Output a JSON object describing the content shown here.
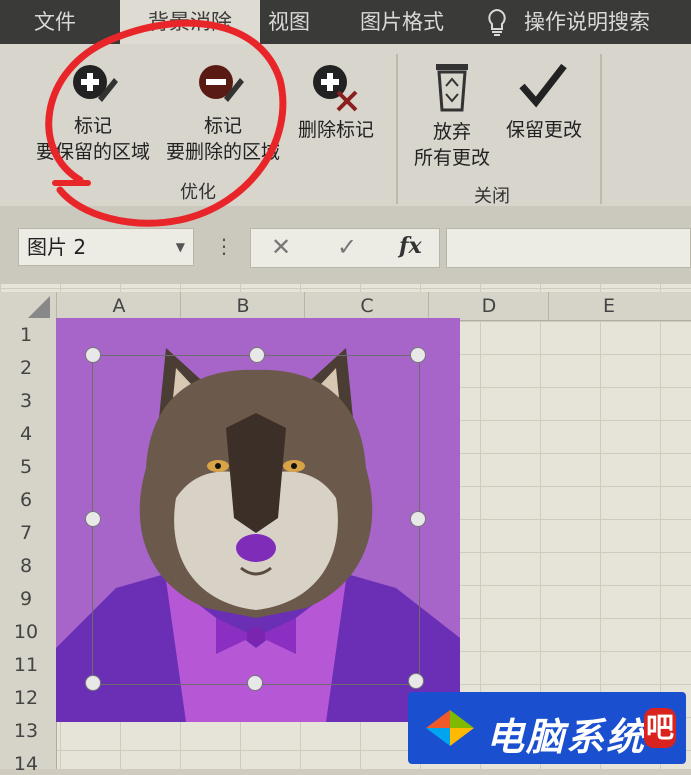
{
  "tabs": {
    "file": "文件",
    "background_removal": "背景消除",
    "view": "视图",
    "picture_format": "图片格式",
    "search": "操作说明搜索"
  },
  "ribbon": {
    "mark_keep_line1": "标记",
    "mark_keep_line2": "要保留的区域",
    "mark_remove_line1": "标记",
    "mark_remove_line2": "要删除的区域",
    "delete_mark": "删除标记",
    "discard_line1": "放弃",
    "discard_line2": "所有更改",
    "keep_changes": "保留更改",
    "group_refine": "优化",
    "group_close": "关闭"
  },
  "formula_bar": {
    "name_box": "图片 2",
    "fx": "fx"
  },
  "columns": [
    "A",
    "B",
    "C",
    "D",
    "E"
  ],
  "rows": [
    "1",
    "2",
    "3",
    "4",
    "5",
    "6",
    "7",
    "8",
    "9",
    "10",
    "11",
    "12",
    "13",
    "14"
  ],
  "watermark": {
    "text": "电脑系统",
    "badge": "吧"
  },
  "colors": {
    "picture_background": "#a764c9",
    "annotation_circle": "#e8262a",
    "logo_blue": "#1a4fd0"
  }
}
